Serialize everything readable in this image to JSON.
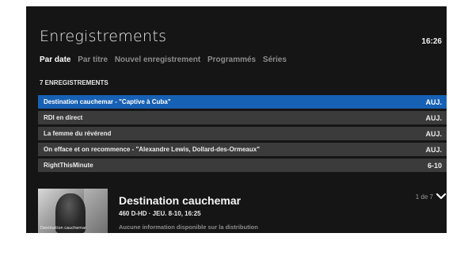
{
  "header": {
    "title": "Enregistrements",
    "clock": "16:26"
  },
  "tabs": [
    {
      "label": "Par date",
      "active": true
    },
    {
      "label": "Par titre",
      "active": false
    },
    {
      "label": "Nouvel enregistrement",
      "active": false
    },
    {
      "label": "Programmés",
      "active": false
    },
    {
      "label": "Séries",
      "active": false
    }
  ],
  "recordings": {
    "count_label": "7 ENREGISTREMENTS",
    "items": [
      {
        "title": "Destination cauchemar - \"Captive à Cuba\"",
        "date": "AUJ.",
        "selected": true
      },
      {
        "title": "RDI en direct",
        "date": "AUJ.",
        "selected": false
      },
      {
        "title": "La femme du révérend",
        "date": "AUJ.",
        "selected": false
      },
      {
        "title": "On efface et on recommence - \"Alexandre Lewis, Dollard-des-Ormeaux\"",
        "date": "AUJ.",
        "selected": false
      },
      {
        "title": "RightThisMinute",
        "date": "6-10",
        "selected": false
      }
    ]
  },
  "detail": {
    "title": "Destination cauchemar",
    "subtitle": "460 D-HD · JEU. 8-10, 16:25",
    "cast": "Aucune information disponible sur la distribution",
    "thumbnail_caption": "Destination cauchemar",
    "pager": "1 de 7",
    "pager_icon": "chevron-down-icon"
  },
  "colors": {
    "background": "#151515",
    "row": "#3b3b3b",
    "selected_row": "#1761b5",
    "muted_text": "#8d8d8d"
  }
}
